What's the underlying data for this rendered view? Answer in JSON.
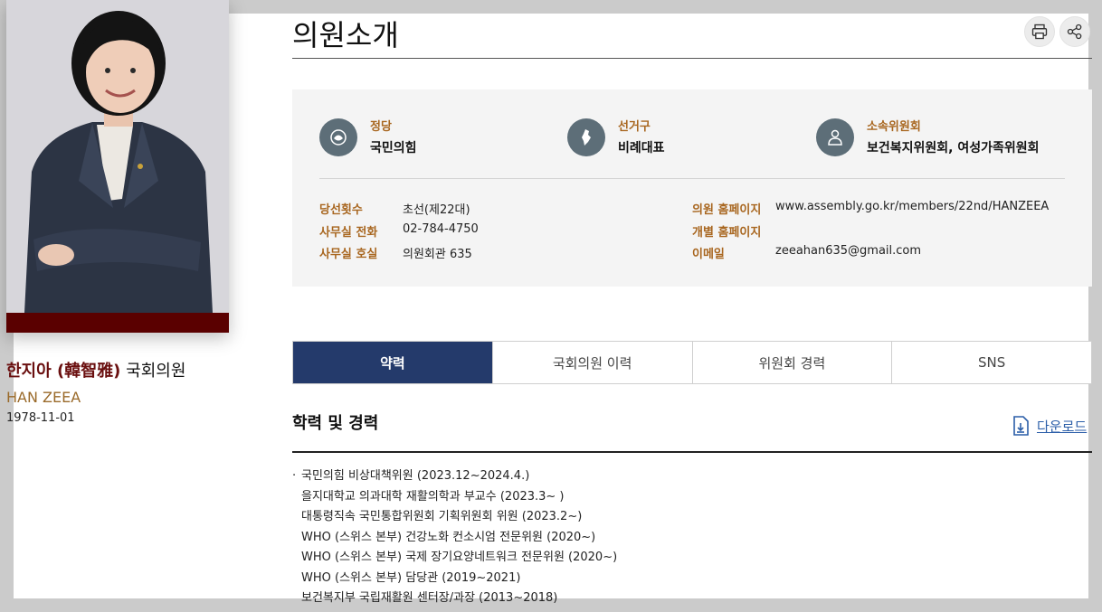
{
  "page_title": "의원소개",
  "profile": {
    "name_ko": "한지아 (韓智雅)",
    "name_suffix": "국회의원",
    "name_en": "HAN ZEEA",
    "birth": "1978-11-01"
  },
  "summary": {
    "party_label": "정당",
    "party_value": "국민의힘",
    "district_label": "선거구",
    "district_value": "비례대표",
    "committee_label": "소속위원회",
    "committee_value": "보건복지위원회, 여성가족위원회"
  },
  "details": {
    "terms_label": "당선횟수",
    "terms_value": "초선(제22대)",
    "phone_label": "사무실 전화",
    "phone_value": "02-784-4750",
    "room_label": "사무실 호실",
    "room_value": "의원회관 635",
    "homepage_label": "의원 홈페이지",
    "homepage_value": "www.assembly.go.kr/members/22nd/HANZEEA",
    "personal_homepage_label": "개별 홈페이지",
    "personal_homepage_value": "",
    "email_label": "이메일",
    "email_value": "zeeahan635@gmail.com"
  },
  "tabs": [
    {
      "label": "약력",
      "active": true
    },
    {
      "label": "국회의원 이력",
      "active": false
    },
    {
      "label": "위원회 경력",
      "active": false
    },
    {
      "label": "SNS",
      "active": false
    }
  ],
  "career": {
    "title": "학력 및 경력",
    "download_label": "다운로드",
    "items": [
      "국민의힘 비상대책위원 (2023.12~2024.4.)",
      "을지대학교 의과대학 재활의학과 부교수 (2023.3~ )",
      "대통령직속 국민통합위원회 기획위원회 위원 (2023.2~)",
      "WHO (스위스 본부) 건강노화 컨소시엄 전문위원 (2020~)",
      "WHO (스위스  본부) 국제 장기요양네트워크 전문위원 (2020~)",
      "WHO (스위스  본부) 담당관 (2019~2021)",
      "보건복지부 국립재활원 센터장/과장 (2013~2018)"
    ]
  },
  "icons": {
    "print": "print-icon",
    "share": "share-icon",
    "party": "party-emblem-icon",
    "district": "map-icon",
    "committee": "person-icon",
    "download": "download-file-icon"
  },
  "colors": {
    "accent_gold": "#a8661f",
    "tab_active": "#243a6b",
    "name_red": "#6a0f0f",
    "link_blue": "#2b5ea8"
  }
}
